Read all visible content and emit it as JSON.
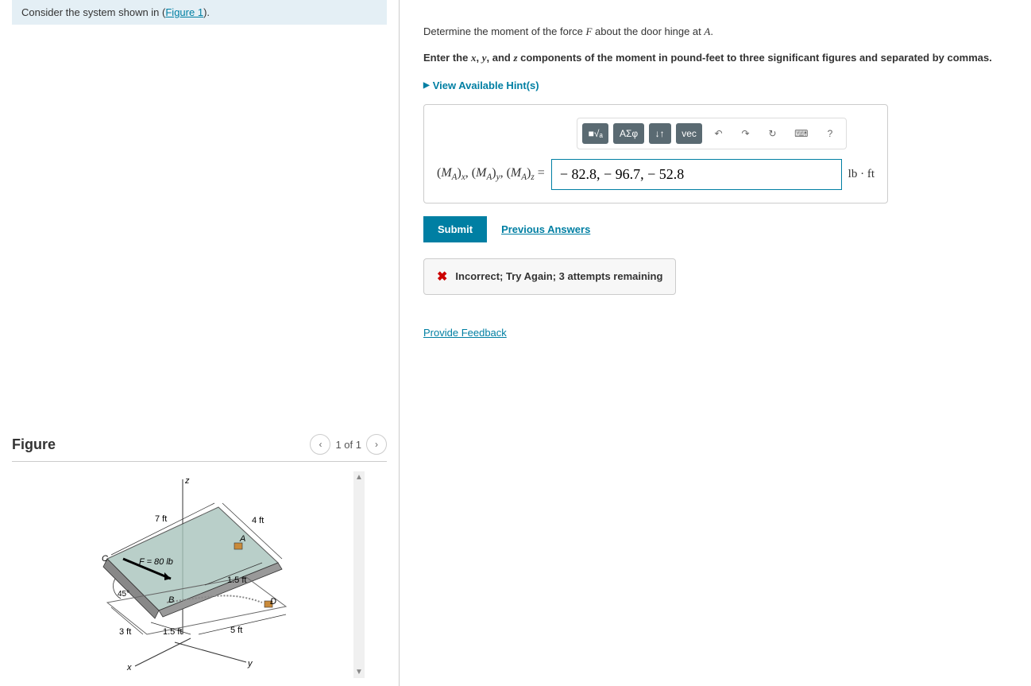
{
  "intro": {
    "prefix": "Consider the system shown in (",
    "link": "Figure 1",
    "suffix": ")."
  },
  "figure": {
    "title": "Figure",
    "page": "1 of 1",
    "labels": {
      "force": "F = 80 lb",
      "angle": "45°",
      "d7": "7 ft",
      "d4": "4 ft",
      "d3": "3 ft",
      "d5": "5 ft",
      "d15a": "1.5 ft",
      "d15b": "1.5 ft",
      "A": "A",
      "B": "B",
      "C": "C",
      "D": "D",
      "x": "x",
      "y": "y",
      "z": "z"
    }
  },
  "question": {
    "p1a": "Determine the moment of the force ",
    "p1b": " about the door hinge at ",
    "p1c": ".",
    "F": "F",
    "A": "A",
    "instr_a": "Enter the ",
    "instr_b": ", ",
    "instr_c": ", and ",
    "instr_d": " components of the moment in pound-feet to three significant figures and separated by commas.",
    "x": "x",
    "y": "y",
    "z": "z"
  },
  "hints": "View Available Hint(s)",
  "toolbar": {
    "templates": "■√ₐ",
    "greek": "ΑΣφ",
    "subsup": "↓↑",
    "vec": "vec",
    "help": "?"
  },
  "answer": {
    "label": "(Mₐ)ₓ, (Mₐ)ᵧ, (Mₐ)_z =",
    "value": "− 82.8, − 96.7, − 52.8",
    "unit": "lb · ft"
  },
  "submit": "Submit",
  "prev_answers": "Previous Answers",
  "feedback": "Incorrect; Try Again; 3 attempts remaining",
  "provide_feedback": "Provide Feedback"
}
